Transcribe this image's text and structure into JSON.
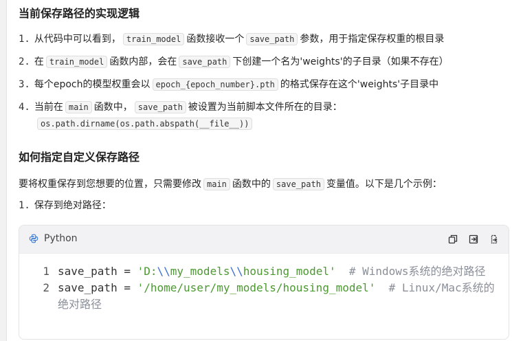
{
  "section1": {
    "title": "当前保存路径的实现逻辑",
    "items": [
      {
        "num": "1.",
        "t1": "从代码中可以看到，",
        "c1": "train_model",
        "t2": "函数接收一个",
        "c2": "save_path",
        "t3": "参数，用于指定保存权重的根目录"
      },
      {
        "num": "2.",
        "t1": "在",
        "c1": "train_model",
        "t2": "函数内部，会在",
        "c2": "save_path",
        "t3": "下创建一个名为'weights'的子目录（如果不存在）"
      },
      {
        "num": "3.",
        "t1": "每个epoch的模型权重会以",
        "c1": "epoch_{epoch_number}.pth",
        "t2": "的格式保存在这个'weights'子目录中"
      },
      {
        "num": "4.",
        "t1": "当前在",
        "c1": "main",
        "t2": "函数中，",
        "c2": "save_path",
        "t3": "被设置为当前脚本文件所在的目录：",
        "c3": "os.path.dirname(os.path.abspath(__file__))"
      }
    ]
  },
  "section2": {
    "title": "如何指定自定义保存路径",
    "intro": {
      "t1": "要将权重保存到您想要的位置，只需要修改",
      "c1": "main",
      "t2": "函数中的",
      "c2": "save_path",
      "t3": "变量值。以下是几个示例："
    },
    "step": {
      "num": "1.",
      "text": "保存到绝对路径："
    }
  },
  "codeblock": {
    "language": "Python",
    "lines": [
      {
        "n": "1",
        "pre": "save_path = ",
        "s1": "'D:",
        "e1": "\\\\",
        "s2": "my_models",
        "e2": "\\\\",
        "s3": "housing_model'",
        "comment": "  # Windows系统的绝对路径"
      },
      {
        "n": "2",
        "pre": "save_path = ",
        "s1": "'/home/user/my_models/housing_model'",
        "comment": "  # Linux/Mac系统的绝对路径"
      }
    ]
  }
}
